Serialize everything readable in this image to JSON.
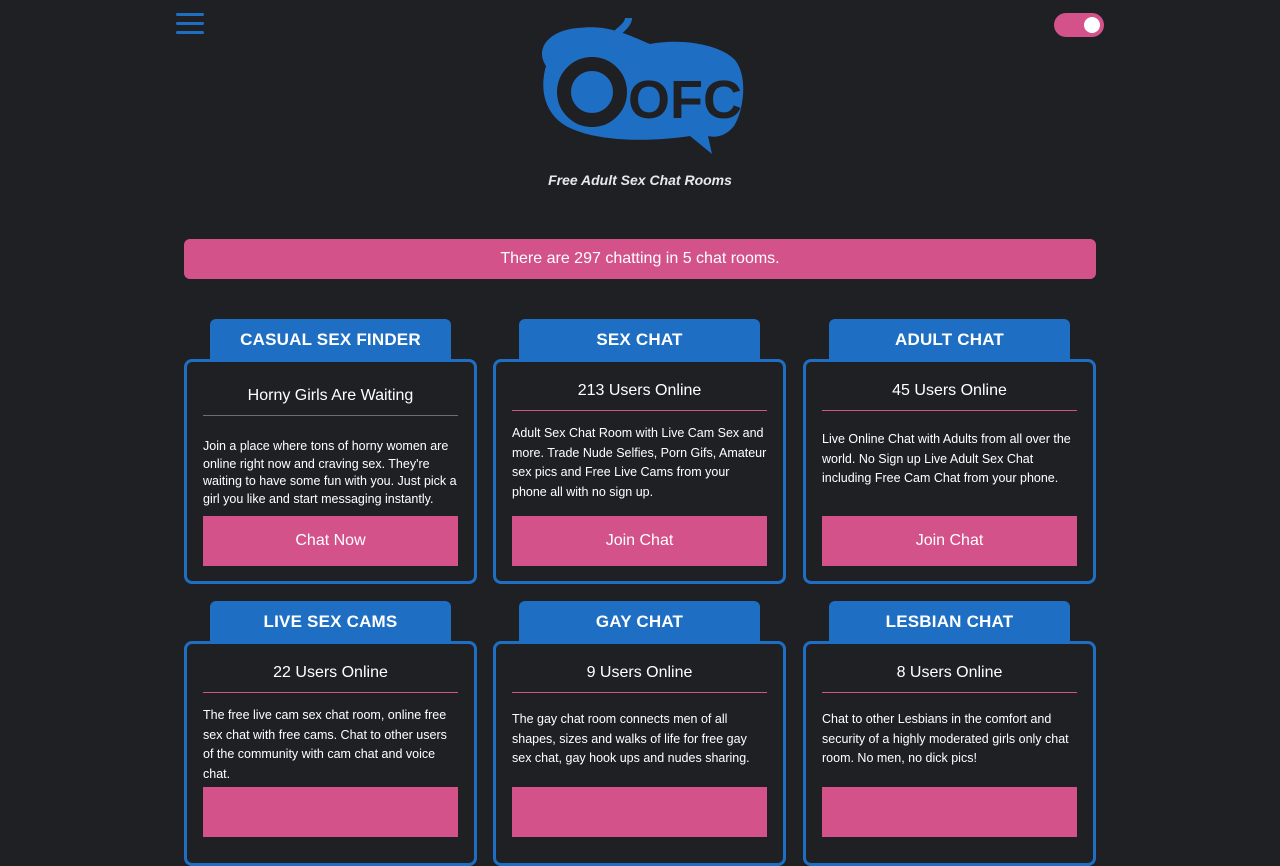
{
  "header": {
    "tagline": "Free Adult Sex Chat Rooms",
    "logo_text": "OFC",
    "menu_icon": "hamburger-menu-icon",
    "toggle_state": "on"
  },
  "banner": {
    "text": "There are 297 chatting in 5 chat rooms."
  },
  "colors": {
    "background": "#1f2024",
    "accent_blue": "#1e6fc4",
    "accent_pink": "#d4528a"
  },
  "rooms": [
    {
      "title": "CASUAL SEX FINDER",
      "subtitle": "Horny Girls Are Waiting",
      "description": "Join a place where tons of horny women are online right now and craving sex. They're waiting to have some fun with you. Just pick a girl you like and start messaging instantly.",
      "button": "Chat Now"
    },
    {
      "title": "SEX CHAT",
      "subtitle": "213 Users Online",
      "description": "Adult Sex Chat Room with Live Cam Sex and more. Trade Nude Selfies, Porn Gifs, Amateur sex pics and Free Live Cams from your phone all with no sign up.",
      "button": "Join Chat"
    },
    {
      "title": "ADULT CHAT",
      "subtitle": "45 Users Online",
      "description": "Live Online Chat with Adults from all over the world. No Sign up Live Adult Sex Chat including Free Cam Chat from your phone.",
      "button": "Join Chat"
    },
    {
      "title": "LIVE SEX CAMS",
      "subtitle": "22 Users Online",
      "description": "The free live cam sex chat room, online free sex chat with free cams. Chat to other users of the community with cam chat and voice chat.",
      "button": ""
    },
    {
      "title": "GAY CHAT",
      "subtitle": "9 Users Online",
      "description": "The gay chat room connects men of all shapes, sizes and walks of life for free gay sex chat, gay hook ups and nudes sharing.",
      "button": ""
    },
    {
      "title": "LESBIAN CHAT",
      "subtitle": "8 Users Online",
      "description": "Chat to other Lesbians in the comfort and security of a highly moderated girls only chat room. No men, no dick pics!",
      "button": ""
    }
  ]
}
